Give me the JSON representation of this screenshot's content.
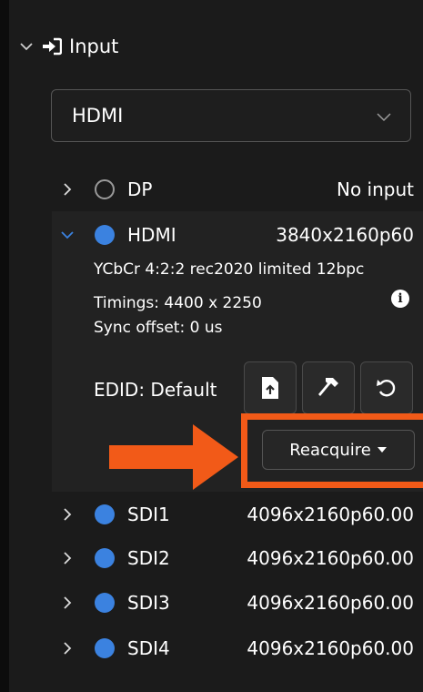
{
  "panel": {
    "section_title": "Input"
  },
  "source_select": {
    "value": "HDMI"
  },
  "inputs": [
    {
      "name": "DP",
      "status": "No input",
      "active": false,
      "expanded": false
    },
    {
      "name": "HDMI",
      "status": "3840x2160p60",
      "active": true,
      "expanded": true
    },
    {
      "name": "SDI1",
      "status": "4096x2160p60.00",
      "active": true,
      "expanded": false
    },
    {
      "name": "SDI2",
      "status": "4096x2160p60.00",
      "active": true,
      "expanded": false
    },
    {
      "name": "SDI3",
      "status": "4096x2160p60.00",
      "active": true,
      "expanded": false
    },
    {
      "name": "SDI4",
      "status": "4096x2160p60.00",
      "active": true,
      "expanded": false
    }
  ],
  "hdmi_details": {
    "format": "YCbCr 4:2:2 rec2020 limited 12bpc",
    "timings": "Timings: 4400 x 2250",
    "sync_offset": "Sync offset: 0 us",
    "edid_label": "EDID: Default",
    "reacquire_label": "Reacquire",
    "info_glyph": "i"
  },
  "colors": {
    "active_dot": "#3b82e0",
    "highlight": "#f25a18",
    "panel_bg": "#1b1b1b"
  },
  "icons": [
    "chevron-down-icon",
    "login-arrow-icon",
    "upload-file-icon",
    "hammer-icon",
    "reset-icon",
    "info-icon",
    "caret-down-icon"
  ]
}
